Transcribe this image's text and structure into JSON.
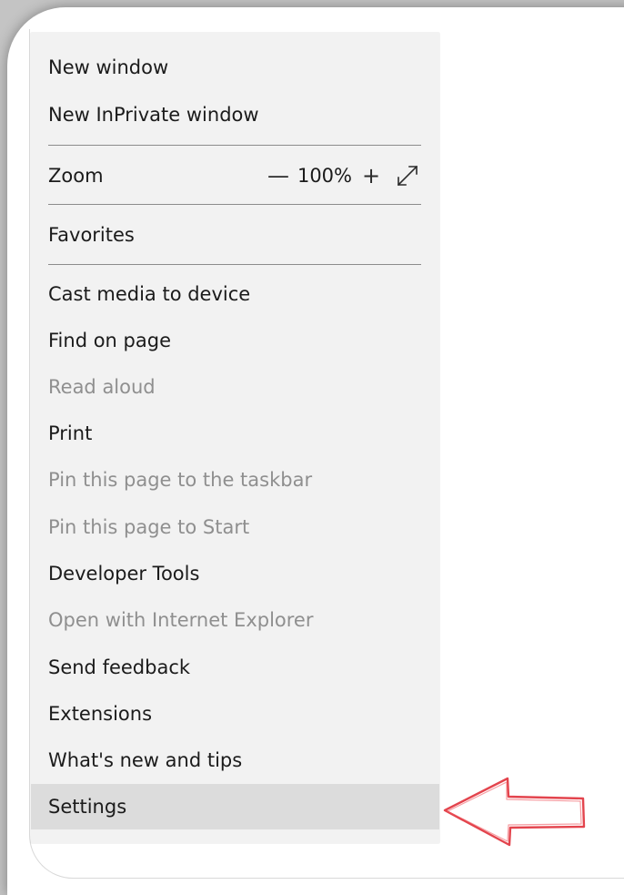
{
  "menu": {
    "items_top": [
      {
        "label": "New window",
        "enabled": true
      },
      {
        "label": "New InPrivate window",
        "enabled": true
      }
    ],
    "zoom": {
      "label": "Zoom",
      "zoom_out_symbol": "—",
      "value": "100%",
      "zoom_in_symbol": "+",
      "fullscreen_icon": "expand-diagonal-icon"
    },
    "favorites": {
      "label": "Favorites",
      "enabled": true
    },
    "items_bottom": [
      {
        "label": "Cast media to device",
        "enabled": true
      },
      {
        "label": "Find on page",
        "enabled": true
      },
      {
        "label": "Read aloud",
        "enabled": false
      },
      {
        "label": "Print",
        "enabled": true
      },
      {
        "label": "Pin this page to the taskbar",
        "enabled": false
      },
      {
        "label": "Pin this page to Start",
        "enabled": false
      },
      {
        "label": "Developer Tools",
        "enabled": true
      },
      {
        "label": "Open with Internet Explorer",
        "enabled": false
      },
      {
        "label": "Send feedback",
        "enabled": true
      },
      {
        "label": "Extensions",
        "enabled": true
      },
      {
        "label": "What's new and tips",
        "enabled": true
      },
      {
        "label": "Settings",
        "enabled": true,
        "highlighted": true
      }
    ]
  },
  "colors": {
    "menu_background": "#f2f2f2",
    "highlight": "#dcdcdc",
    "text": "#1b1b1b",
    "disabled_text": "#8f8f8f",
    "arrow": "#e0303a"
  },
  "annotation": {
    "arrow_icon": "left-arrow-callout-icon",
    "points_to": "Settings"
  }
}
